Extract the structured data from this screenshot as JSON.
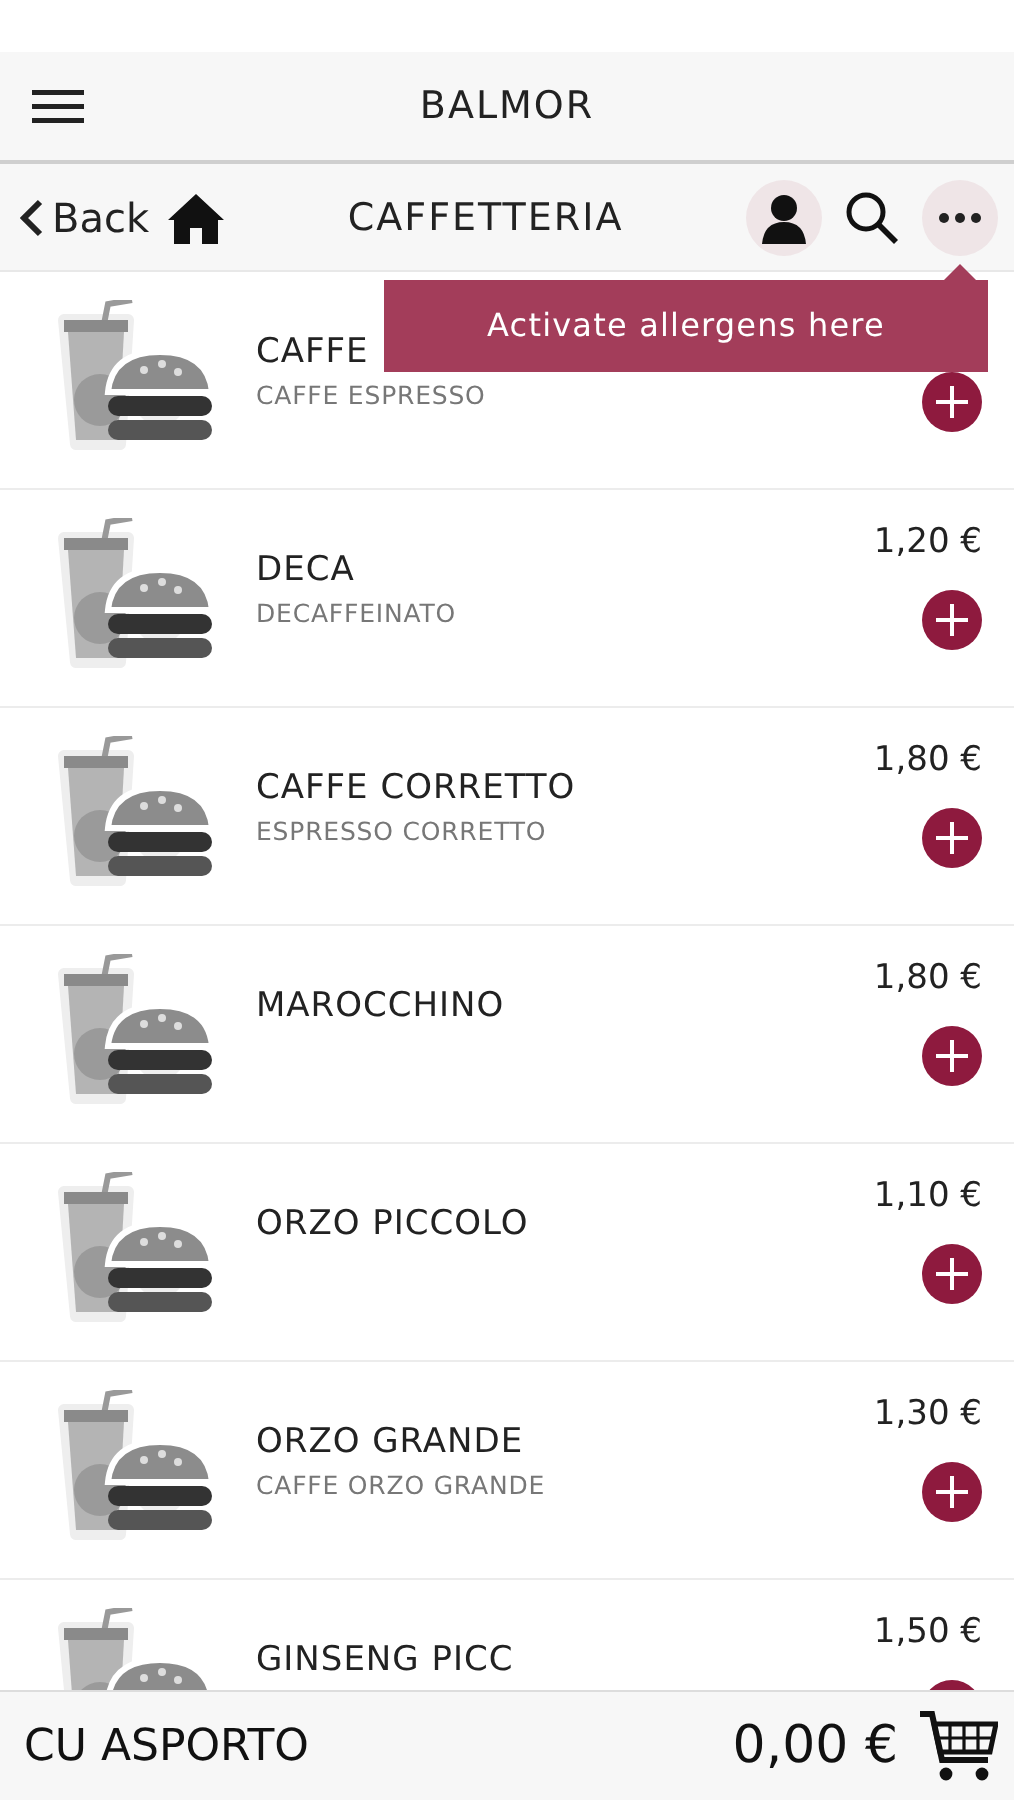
{
  "header": {
    "title": "BALMOR"
  },
  "nav": {
    "back": "Back",
    "title": "CAFFETTERIA"
  },
  "tooltip": {
    "text": "Activate allergens here"
  },
  "items": [
    {
      "name": "CAFFE",
      "description": "CAFFE ESPRESSO"
    },
    {
      "name": "DECA",
      "description": "DECAFFEINATO",
      "price": "1,20 €"
    },
    {
      "name": "CAFFE CORRETTO",
      "description": "ESPRESSO CORRETTO",
      "price": "1,80 €"
    },
    {
      "name": "MAROCCHINO",
      "price": "1,80 €"
    },
    {
      "name": "ORZO PICCOLO",
      "price": "1,10 €"
    },
    {
      "name": "ORZO GRANDE",
      "description": "CAFFE ORZO GRANDE",
      "price": "1,30 €"
    },
    {
      "name": "GINSENG PICC",
      "price": "1,50 €"
    }
  ],
  "footer": {
    "label": "CU ASPORTO",
    "total": "0,00 €"
  }
}
